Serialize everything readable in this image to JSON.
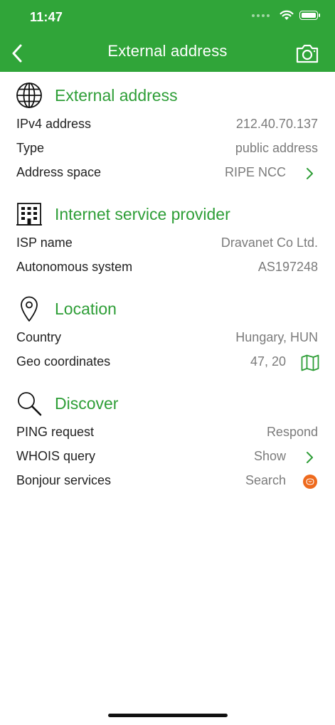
{
  "status_bar": {
    "time": "11:47"
  },
  "nav": {
    "title": "External address",
    "back_icon": "chevron-left-icon",
    "camera_icon": "camera-icon"
  },
  "colors": {
    "accent": "#30a539",
    "section_title": "#2e9e37",
    "value_text": "#7b7b7b",
    "bonjour_badge": "#ee6a1d"
  },
  "sections": [
    {
      "title": "External address",
      "icon": "globe-icon",
      "rows": [
        {
          "label": "IPv4 address",
          "value": "212.40.70.137"
        },
        {
          "label": "Type",
          "value": "public address"
        },
        {
          "label": "Address space",
          "value": "RIPE NCC",
          "accessory": "chevron-right-icon"
        }
      ]
    },
    {
      "title": "Internet service provider",
      "icon": "building-icon",
      "rows": [
        {
          "label": "ISP name",
          "value": "Dravanet Co Ltd."
        },
        {
          "label": "Autonomous system",
          "value": "AS197248"
        }
      ]
    },
    {
      "title": "Location",
      "icon": "map-pin-icon",
      "rows": [
        {
          "label": "Country",
          "value": "Hungary, HUN"
        },
        {
          "label": "Geo coordinates",
          "value": "47, 20",
          "accessory": "map-icon"
        }
      ]
    },
    {
      "title": "Discover",
      "icon": "magnifier-icon",
      "rows": [
        {
          "label": "PING request",
          "value": "Respond"
        },
        {
          "label": "WHOIS query",
          "value": "Show",
          "accessory": "chevron-right-icon"
        },
        {
          "label": "Bonjour services",
          "value": "Search",
          "accessory": "bonjour-icon"
        }
      ]
    }
  ]
}
